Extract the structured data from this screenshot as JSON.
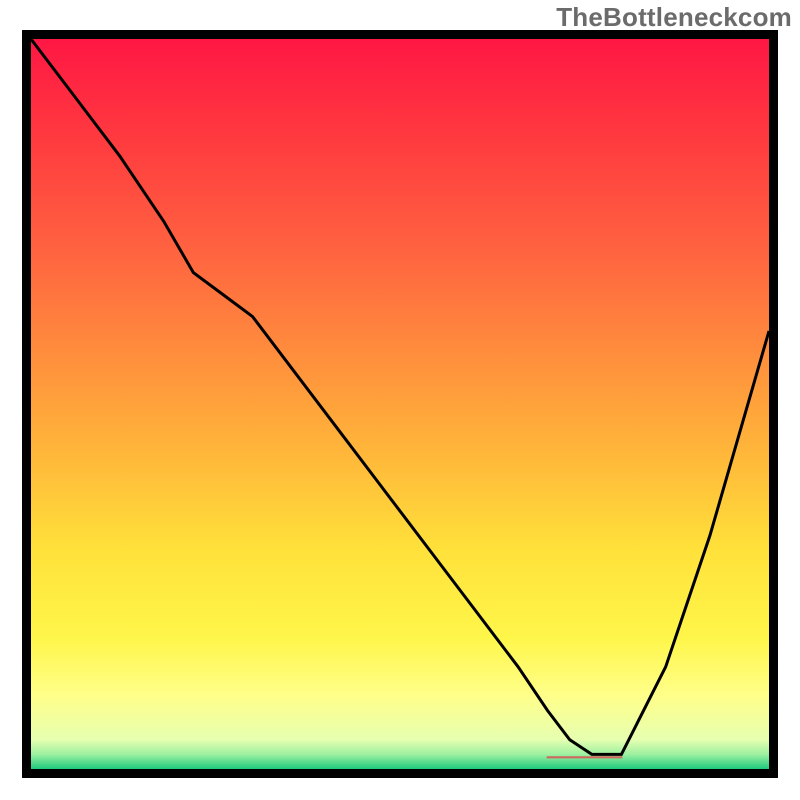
{
  "watermark": "TheBottleneckcom",
  "chart_data": {
    "type": "line",
    "title": "",
    "xlabel": "",
    "ylabel": "",
    "xlim": [
      0,
      100
    ],
    "ylim": [
      0,
      100
    ],
    "grid": false,
    "legend": false,
    "background_gradient": {
      "stops": [
        {
          "offset": 0.0,
          "color": "#ff1744"
        },
        {
          "offset": 0.14,
          "color": "#ff3b3f"
        },
        {
          "offset": 0.28,
          "color": "#ff6040"
        },
        {
          "offset": 0.42,
          "color": "#ff8a3d"
        },
        {
          "offset": 0.56,
          "color": "#ffb43a"
        },
        {
          "offset": 0.7,
          "color": "#ffe13a"
        },
        {
          "offset": 0.82,
          "color": "#fff64a"
        },
        {
          "offset": 0.9,
          "color": "#ffff8a"
        },
        {
          "offset": 0.96,
          "color": "#e6ffb0"
        },
        {
          "offset": 0.98,
          "color": "#9df0a0"
        },
        {
          "offset": 1.0,
          "color": "#1ec97d"
        }
      ]
    },
    "series": [
      {
        "name": "bottleneck-curve",
        "color": "#000000",
        "width": 3,
        "x": [
          0,
          6,
          12,
          18,
          22,
          26,
          30,
          36,
          42,
          48,
          54,
          60,
          66,
          70,
          73,
          76,
          80,
          86,
          92,
          96,
          100
        ],
        "y": [
          100,
          92,
          84,
          75,
          68,
          65,
          62,
          54,
          46,
          38,
          30,
          22,
          14,
          8,
          4,
          2,
          2,
          14,
          32,
          46,
          60
        ]
      }
    ],
    "marker": {
      "name": "optimal-segment",
      "color": "#d1675e",
      "x_start": 70,
      "x_end": 80,
      "y": 1.6,
      "thickness": 2.2
    }
  }
}
